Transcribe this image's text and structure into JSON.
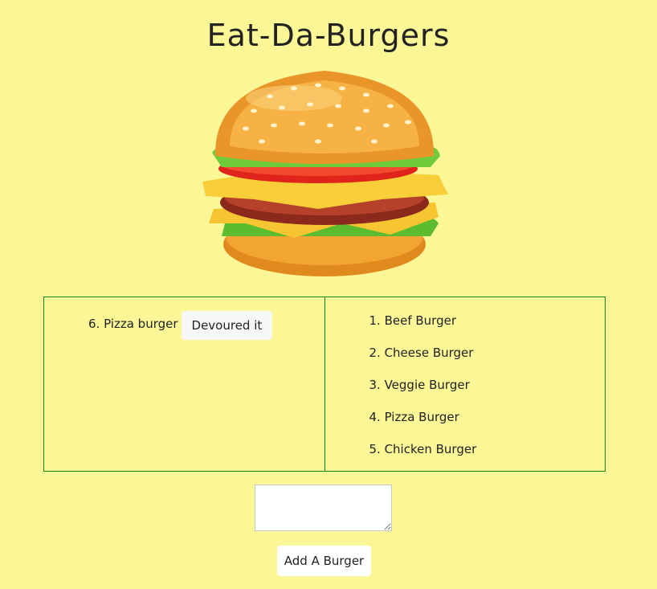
{
  "header": {
    "title": "Eat-Da-Burgers"
  },
  "uneaten": [
    {
      "label": "6. Pizza burger",
      "button_label": "Devoured it"
    }
  ],
  "devoured": [
    "1. Beef Burger",
    "2. Cheese Burger",
    "3. Veggie Burger",
    "4. Pizza Burger",
    "5. Chicken Burger"
  ],
  "form": {
    "input_value": "",
    "submit_label": "Add A Burger"
  },
  "colors": {
    "background": "#fbf796",
    "panel_border": "#1a8a1a",
    "button_bg": "#f7f7f8"
  },
  "icons": {
    "hero": "burger-illustration"
  }
}
